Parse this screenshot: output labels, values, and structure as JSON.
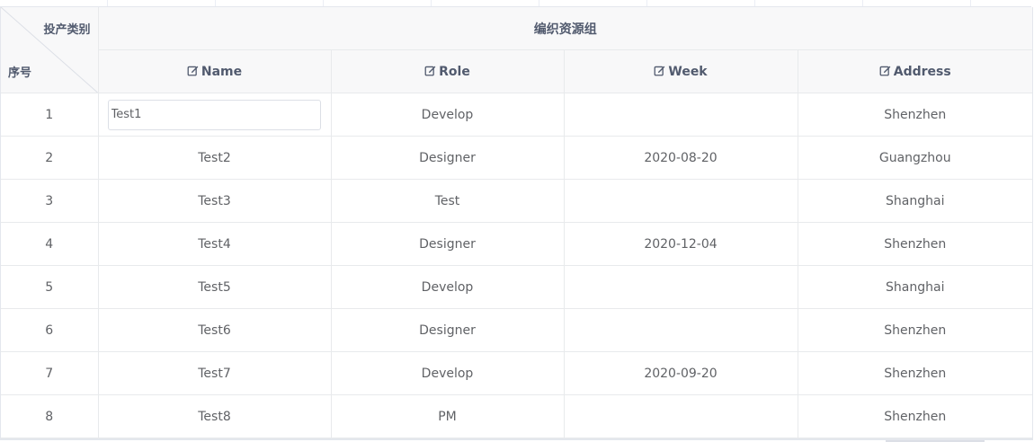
{
  "corner": {
    "top_label": "投产类别",
    "bottom_label": "序号"
  },
  "group_header": "编织资源组",
  "columns": [
    {
      "label": "Name",
      "icon": "edit-icon"
    },
    {
      "label": "Role",
      "icon": "edit-icon"
    },
    {
      "label": "Week",
      "icon": "edit-icon"
    },
    {
      "label": "Address",
      "icon": "edit-icon"
    }
  ],
  "rows": [
    {
      "seq": "1",
      "name": "Test1",
      "role": "Develop",
      "week": "",
      "address": "Shenzhen",
      "editing": true
    },
    {
      "seq": "2",
      "name": "Test2",
      "role": "Designer",
      "week": "2020-08-20",
      "address": "Guangzhou"
    },
    {
      "seq": "3",
      "name": "Test3",
      "role": "Test",
      "week": "",
      "address": "Shanghai"
    },
    {
      "seq": "4",
      "name": "Test4",
      "role": "Designer",
      "week": "2020-12-04",
      "address": "Shenzhen"
    },
    {
      "seq": "5",
      "name": "Test5",
      "role": "Develop",
      "week": "",
      "address": "Shanghai"
    },
    {
      "seq": "6",
      "name": "Test6",
      "role": "Designer",
      "week": "",
      "address": "Shenzhen"
    },
    {
      "seq": "7",
      "name": "Test7",
      "role": "Develop",
      "week": "2020-09-20",
      "address": "Shenzhen"
    },
    {
      "seq": "8",
      "name": "Test8",
      "role": "PM",
      "week": "",
      "address": "Shenzhen"
    }
  ],
  "colors": {
    "border": "#e8eaec",
    "header_bg": "#f8f8f9",
    "text": "#606266",
    "header_text": "#515a6e"
  }
}
